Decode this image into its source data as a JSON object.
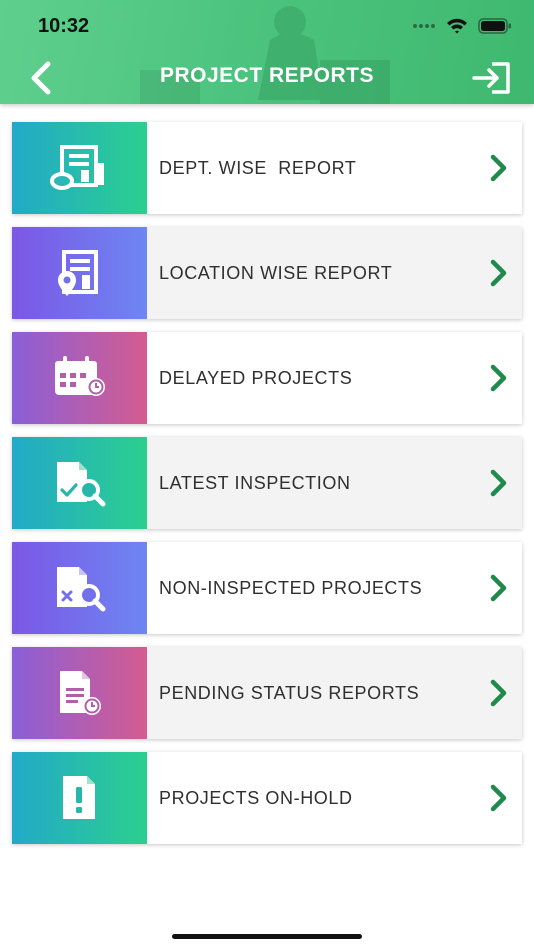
{
  "status_bar": {
    "time": "10:32"
  },
  "header": {
    "title": "PROJECT REPORTS",
    "back_icon": "chevron-left-icon",
    "logout_icon": "logout-icon"
  },
  "colors": {
    "header_green": "#4cc47f",
    "chevron_green": "#1f8a4c",
    "teal": "#2ccf8f",
    "purple": "#7b57e6",
    "pink": "#d45c8f"
  },
  "reports": [
    {
      "label": "DEPT. WISE  REPORT",
      "icon": "building-report-icon"
    },
    {
      "label": "LOCATION WISE REPORT",
      "icon": "location-report-icon"
    },
    {
      "label": "DELAYED PROJECTS",
      "icon": "calendar-clock-icon"
    },
    {
      "label": "LATEST INSPECTION",
      "icon": "inspection-search-icon"
    },
    {
      "label": "NON-INSPECTED PROJECTS",
      "icon": "non-inspected-search-icon"
    },
    {
      "label": "PENDING STATUS REPORTS",
      "icon": "pending-document-icon"
    },
    {
      "label": "PROJECTS ON-HOLD",
      "icon": "alert-document-icon"
    }
  ]
}
